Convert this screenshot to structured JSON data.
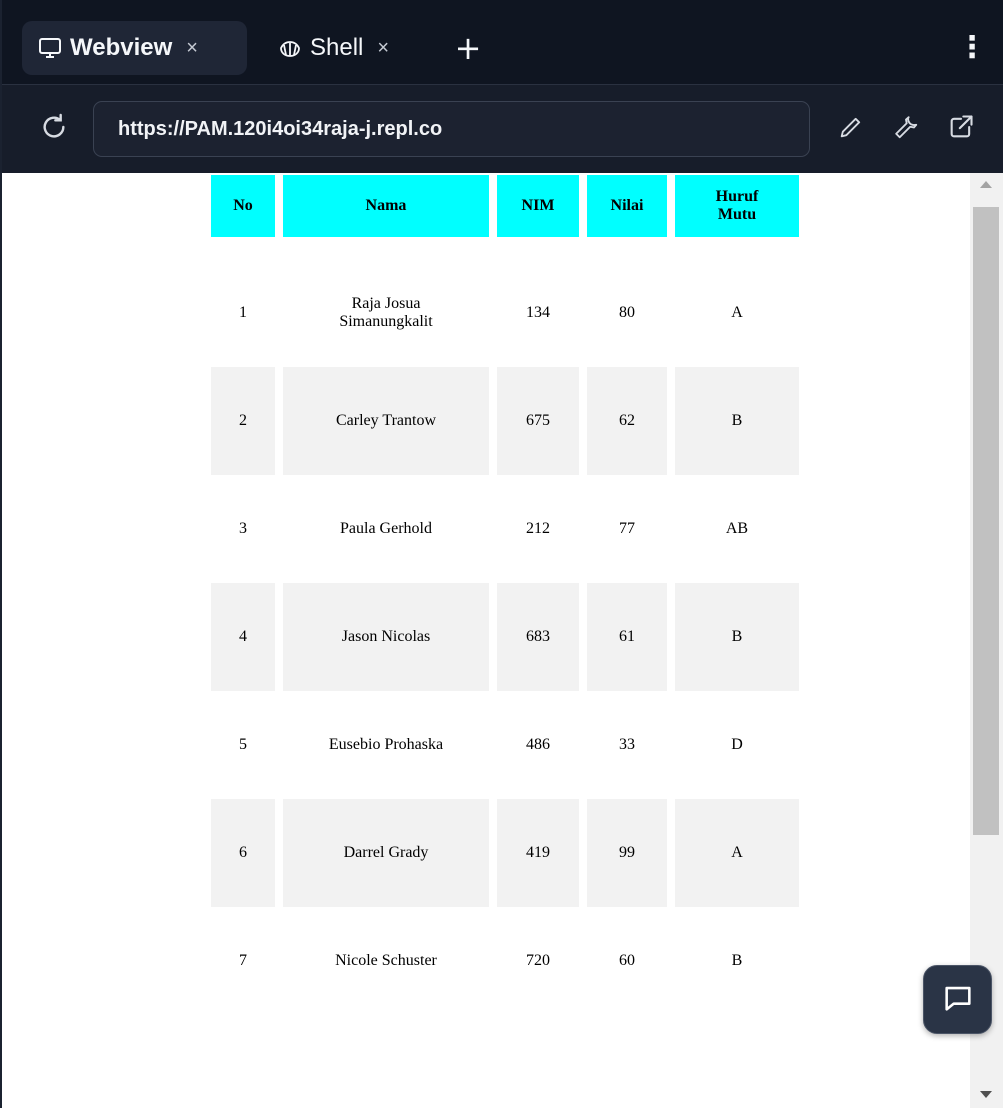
{
  "tabs": [
    {
      "label": "Webview",
      "icon": "monitor-icon",
      "active": true,
      "close": "×"
    },
    {
      "label": "Shell",
      "icon": "shell-icon",
      "active": false,
      "close": "×"
    }
  ],
  "tabbar": {
    "add_label": "+",
    "menu_label": "⋮"
  },
  "address": {
    "url": "https://PAM.120i4oi34raja-j.repl.co"
  },
  "table": {
    "headers": {
      "no": "No",
      "nama": "Nama",
      "nim": "NIM",
      "nilai": "Nilai",
      "huruf": "Huruf Mutu"
    },
    "rows": [
      {
        "no": "1",
        "nama": "Raja Josua Simanungkalit",
        "nim": "134",
        "nilai": "80",
        "huruf": "A"
      },
      {
        "no": "2",
        "nama": "Carley Trantow",
        "nim": "675",
        "nilai": "62",
        "huruf": "B"
      },
      {
        "no": "3",
        "nama": "Paula Gerhold",
        "nim": "212",
        "nilai": "77",
        "huruf": "AB"
      },
      {
        "no": "4",
        "nama": "Jason Nicolas",
        "nim": "683",
        "nilai": "61",
        "huruf": "B"
      },
      {
        "no": "5",
        "nama": "Eusebio Prohaska",
        "nim": "486",
        "nilai": "33",
        "huruf": "D"
      },
      {
        "no": "6",
        "nama": "Darrel Grady",
        "nim": "419",
        "nilai": "99",
        "huruf": "A"
      },
      {
        "no": "7",
        "nama": "Nicole Schuster",
        "nim": "720",
        "nilai": "60",
        "huruf": "B"
      }
    ]
  },
  "colors": {
    "header_bg": "#00ffff",
    "even_row_bg": "#f2f2f2",
    "chrome_bg": "#0f1521"
  }
}
